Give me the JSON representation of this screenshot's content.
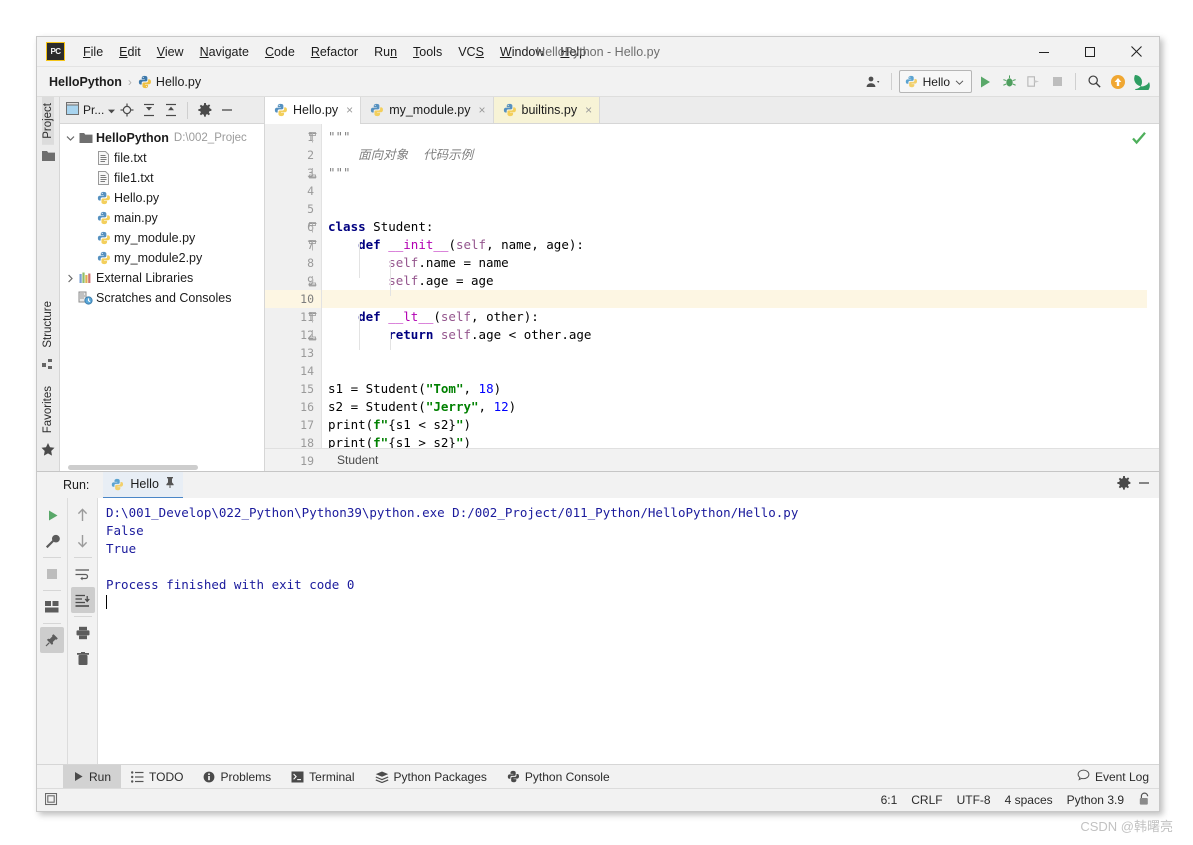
{
  "window": {
    "title": "HelloPython - Hello.py",
    "logo_text": "PC",
    "minimize_label": "minimize",
    "maximize_label": "maximize",
    "close_label": "close"
  },
  "menubar": {
    "items": [
      {
        "label": "File",
        "mnemonic": "F"
      },
      {
        "label": "Edit",
        "mnemonic": "E"
      },
      {
        "label": "View",
        "mnemonic": "V"
      },
      {
        "label": "Navigate",
        "mnemonic": "N"
      },
      {
        "label": "Code",
        "mnemonic": "C"
      },
      {
        "label": "Refactor",
        "mnemonic": "R"
      },
      {
        "label": "Run",
        "mnemonic": "n"
      },
      {
        "label": "Tools",
        "mnemonic": "T"
      },
      {
        "label": "VCS",
        "mnemonic": "S"
      },
      {
        "label": "Window",
        "mnemonic": "W"
      },
      {
        "label": "Help",
        "mnemonic": "H"
      }
    ]
  },
  "navbar": {
    "project_crumb": "HelloPython",
    "separator": "›",
    "file_crumb": "Hello.py",
    "run_config": "Hello",
    "run_config_caret": "∨",
    "buttons": [
      "user-icon",
      "run-button",
      "debug-button",
      "run-coverage-button",
      "stop-button",
      "search-button",
      "update-button",
      "profile-button"
    ]
  },
  "left_strip": {
    "top_label": "Project",
    "labels": [
      "Structure",
      "Favorites"
    ]
  },
  "project_panel": {
    "header_title": "Pr...",
    "header_buttons": [
      "locate-icon",
      "expand-all-icon",
      "collapse-all-icon",
      "settings-gear-icon",
      "hide-icon"
    ],
    "tree": [
      {
        "label": "HelloPython",
        "path": "D:\\002_Projec",
        "icon": "folder-icon",
        "arrow": "∨",
        "indent": 0,
        "bold": true
      },
      {
        "label": "file.txt",
        "icon": "text-file-icon",
        "indent": 1
      },
      {
        "label": "file1.txt",
        "icon": "text-file-icon",
        "indent": 1
      },
      {
        "label": "Hello.py",
        "icon": "python-file-icon",
        "indent": 1
      },
      {
        "label": "main.py",
        "icon": "python-file-icon",
        "indent": 1
      },
      {
        "label": "my_module.py",
        "icon": "python-file-icon",
        "indent": 1
      },
      {
        "label": "my_module2.py",
        "icon": "python-file-icon",
        "indent": 1
      },
      {
        "label": "External Libraries",
        "icon": "libraries-icon",
        "arrow": "›",
        "indent": 0
      },
      {
        "label": "Scratches and Consoles",
        "icon": "scratches-icon",
        "indent": 0
      }
    ]
  },
  "editor": {
    "tabs": [
      {
        "label": "Hello.py",
        "state": "active",
        "icon": "python-file-icon",
        "close": "×"
      },
      {
        "label": "my_module.py",
        "state": "normal",
        "icon": "python-file-icon",
        "close": "×"
      },
      {
        "label": "builtins.py",
        "state": "readonly",
        "icon": "python-file-icon",
        "close": "×"
      }
    ],
    "line_numbers": [
      "1",
      "2",
      "3",
      "4",
      "5",
      "6",
      "7",
      "8",
      "9",
      "10",
      "11",
      "12",
      "13",
      "14",
      "15",
      "16",
      "17",
      "18",
      "19"
    ],
    "current_line": 10,
    "inspection_status": "checkmark-ok",
    "breadcrumb": "Student",
    "lines": [
      {
        "n": 1,
        "tokens": [
          {
            "t": "\"\"\"",
            "c": "docq"
          }
        ]
      },
      {
        "n": 2,
        "tokens": [
          {
            "t": "    面向对象  代码示例",
            "c": "doc"
          }
        ]
      },
      {
        "n": 3,
        "tokens": [
          {
            "t": "\"\"\"",
            "c": "docq"
          }
        ]
      },
      {
        "n": 4,
        "tokens": []
      },
      {
        "n": 5,
        "tokens": []
      },
      {
        "n": 6,
        "tokens": [
          {
            "t": "class",
            "c": "kw"
          },
          {
            "t": " Student:",
            "c": "pl"
          }
        ]
      },
      {
        "n": 7,
        "tokens": [
          {
            "t": "    ",
            "c": "pl"
          },
          {
            "t": "def",
            "c": "kw"
          },
          {
            "t": " ",
            "c": "pl"
          },
          {
            "t": "__init__",
            "c": "dunder"
          },
          {
            "t": "(",
            "c": "pl"
          },
          {
            "t": "self",
            "c": "selfk"
          },
          {
            "t": ", name, age):",
            "c": "pl"
          }
        ]
      },
      {
        "n": 8,
        "tokens": [
          {
            "t": "        ",
            "c": "pl"
          },
          {
            "t": "self",
            "c": "selfk"
          },
          {
            "t": ".name = name",
            "c": "pl"
          }
        ]
      },
      {
        "n": 9,
        "tokens": [
          {
            "t": "        ",
            "c": "pl"
          },
          {
            "t": "self",
            "c": "selfk"
          },
          {
            "t": ".age = age",
            "c": "pl"
          }
        ]
      },
      {
        "n": 10,
        "tokens": []
      },
      {
        "n": 11,
        "tokens": [
          {
            "t": "    ",
            "c": "pl"
          },
          {
            "t": "def",
            "c": "kw"
          },
          {
            "t": " ",
            "c": "pl"
          },
          {
            "t": "__lt__",
            "c": "dunder"
          },
          {
            "t": "(",
            "c": "pl"
          },
          {
            "t": "self",
            "c": "selfk"
          },
          {
            "t": ", other):",
            "c": "pl"
          }
        ]
      },
      {
        "n": 12,
        "tokens": [
          {
            "t": "        ",
            "c": "pl"
          },
          {
            "t": "return",
            "c": "kw"
          },
          {
            "t": " ",
            "c": "pl"
          },
          {
            "t": "self",
            "c": "selfk"
          },
          {
            "t": ".age < other.age",
            "c": "pl"
          }
        ]
      },
      {
        "n": 13,
        "tokens": []
      },
      {
        "n": 14,
        "tokens": []
      },
      {
        "n": 15,
        "tokens": [
          {
            "t": "s1 = Student(",
            "c": "pl"
          },
          {
            "t": "\"Tom\"",
            "c": "str"
          },
          {
            "t": ", ",
            "c": "pl"
          },
          {
            "t": "18",
            "c": "num"
          },
          {
            "t": ")",
            "c": "pl"
          }
        ]
      },
      {
        "n": 16,
        "tokens": [
          {
            "t": "s2 = Student(",
            "c": "pl"
          },
          {
            "t": "\"Jerry\"",
            "c": "str"
          },
          {
            "t": ", ",
            "c": "pl"
          },
          {
            "t": "12",
            "c": "num"
          },
          {
            "t": ")",
            "c": "pl"
          }
        ]
      },
      {
        "n": 17,
        "tokens": [
          {
            "t": "print(",
            "c": "pl"
          },
          {
            "t": "f\"",
            "c": "str"
          },
          {
            "t": "{s1 < s2}",
            "c": "pl"
          },
          {
            "t": "\"",
            "c": "str"
          },
          {
            "t": ")",
            "c": "pl"
          }
        ]
      },
      {
        "n": 18,
        "tokens": [
          {
            "t": "print(",
            "c": "pl"
          },
          {
            "t": "f\"",
            "c": "str"
          },
          {
            "t": "{s1 > s2}",
            "c": "pl"
          },
          {
            "t": "\"",
            "c": "str"
          },
          {
            "t": ")",
            "c": "pl"
          }
        ]
      },
      {
        "n": 19,
        "tokens": []
      }
    ],
    "fold_markers": [
      1,
      3,
      6,
      7,
      9,
      11,
      12
    ]
  },
  "run_window": {
    "label": "Run:",
    "tab_label": "Hello",
    "tab_icon": "python-icon",
    "pin_icon": "pin-icon",
    "header_buttons": [
      "settings-gear-icon",
      "hide-icon"
    ],
    "toolbar_left": [
      "rerun-button",
      "settings-wrench-button",
      "stop-button",
      "layout-button",
      "pin-button"
    ],
    "toolbar_right": [
      "up-arrow-button",
      "down-arrow-button",
      "soft-wrap-button",
      "scroll-to-end-button",
      "print-button",
      "clear-all-button"
    ],
    "console_lines": [
      "D:\\001_Develop\\022_Python\\Python39\\python.exe D:/002_Project/011_Python/HelloPython/Hello.py",
      "False",
      "True",
      "",
      "Process finished with exit code 0"
    ]
  },
  "bottom_bar": {
    "items": [
      {
        "label": "Run",
        "icon": "run-icon",
        "selected": true
      },
      {
        "label": "TODO",
        "icon": "todo-icon",
        "selected": false
      },
      {
        "label": "Problems",
        "icon": "problems-icon",
        "selected": false
      },
      {
        "label": "Terminal",
        "icon": "terminal-icon",
        "selected": false
      },
      {
        "label": "Python Packages",
        "icon": "packages-icon",
        "selected": false
      },
      {
        "label": "Python Console",
        "icon": "python-console-icon",
        "selected": false
      }
    ],
    "event_log": "Event Log",
    "event_log_icon": "balloon-icon"
  },
  "status_bar": {
    "layout_icon": "layout-icon",
    "caret_position": "6:1",
    "line_separator": "CRLF",
    "encoding": "UTF-8",
    "indent": "4 spaces",
    "interpreter": "Python 3.9",
    "lock_icon": "lock-icon"
  },
  "watermark": "CSDN @韩曙亮",
  "colors": {
    "accent": "#4a86c7",
    "keyword": "#000080",
    "string": "#008000",
    "number": "#0000ff",
    "dunder": "#b200b2",
    "self": "#94558d",
    "console_text": "#1a1a9c",
    "readonly_tab_bg": "#f7f3d6",
    "current_line_bg": "#fdf6e3"
  }
}
